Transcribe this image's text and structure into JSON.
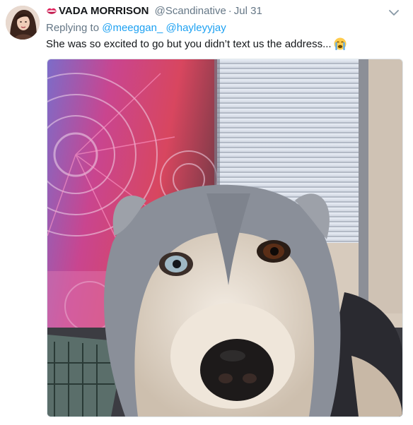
{
  "tweet": {
    "display_name": "VADA MORRISON",
    "handle": "@Scandinative",
    "separator": "·",
    "date": "Jul 31",
    "reply_prefix": "Replying to",
    "mentions": [
      "@meeggan_",
      "@hayleyyjay"
    ],
    "text": "She was so excited to go but you didn’t text us the address...",
    "emoji": "crying-face-emoji",
    "name_emoji": "kiss-mark-icon",
    "media": {
      "subject": "husky-dog-photo"
    }
  },
  "colors": {
    "link": "#1da1f2",
    "secondary_text": "#657786",
    "primary_text": "#14171a"
  }
}
